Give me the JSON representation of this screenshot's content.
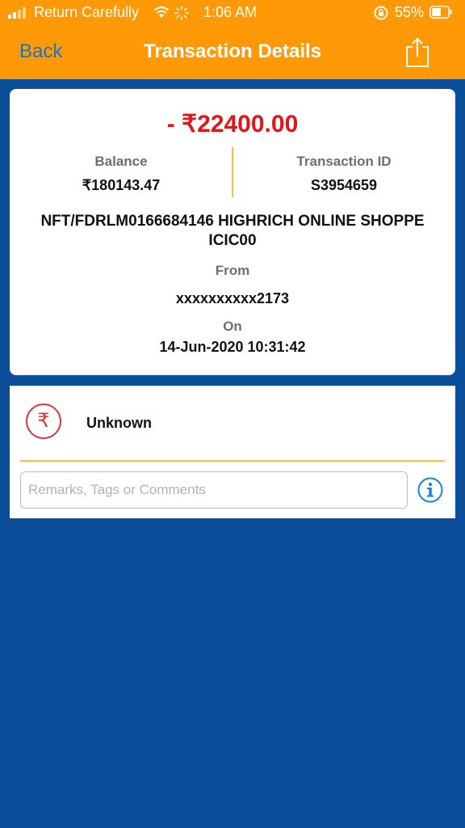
{
  "status_bar": {
    "carrier": "Return Carefully",
    "time": "1:06 AM",
    "battery_pct": "55%"
  },
  "nav": {
    "back_label": "Back",
    "title": "Transaction Details",
    "share_icon": "share-icon"
  },
  "transaction": {
    "amount": "- ₹22400.00",
    "balance_label": "Balance",
    "balance_value": "₹180143.47",
    "id_label": "Transaction ID",
    "id_value": "S3954659",
    "description": "NFT/FDRLM0166684146 HIGHRICH ONLINE SHOPPE ICIC00",
    "from_label": "From",
    "from_value": "xxxxxxxxxx2173",
    "on_label": "On",
    "on_value": "14-Jun-2020 10:31:42"
  },
  "category": {
    "icon": "rupee-icon",
    "symbol": "₹",
    "label": "Unknown"
  },
  "remarks": {
    "placeholder": "Remarks, Tags or Comments",
    "value": ""
  },
  "colors": {
    "header": "#ff9a06",
    "background": "#0b4f9a",
    "amount": "#e0161a",
    "back_link": "#1a73c9",
    "divider": "#f2c23a"
  }
}
